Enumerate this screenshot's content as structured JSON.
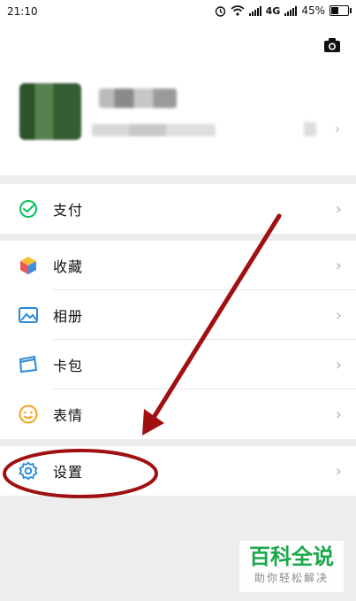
{
  "status_bar": {
    "time": "21:10",
    "network": "4G",
    "battery_percent": "45%",
    "battery_level": 0.45
  },
  "profile": {
    "camera_icon": "camera-icon",
    "avatar": "avatar",
    "name_blurred": true,
    "id_blurred": true
  },
  "menu": {
    "pay": {
      "label": "支付",
      "icon": "wechat-pay-icon",
      "color": "#07c160"
    },
    "favorites": {
      "label": "收藏",
      "icon": "favorites-cube-icon"
    },
    "album": {
      "label": "相册",
      "icon": "album-icon",
      "color": "#2a8ad8"
    },
    "cards": {
      "label": "卡包",
      "icon": "card-wallet-icon",
      "color": "#2a8ad8"
    },
    "stickers": {
      "label": "表情",
      "icon": "sticker-smile-icon",
      "color": "#f2a31b"
    },
    "settings": {
      "label": "设置",
      "icon": "settings-gear-icon",
      "color": "#2a8ad8"
    }
  },
  "watermark": {
    "brand": "百科全说",
    "slogan": "助你轻松解决",
    "color": "#1aa74a"
  },
  "annotation": {
    "color": "#a01010",
    "target": "settings"
  }
}
